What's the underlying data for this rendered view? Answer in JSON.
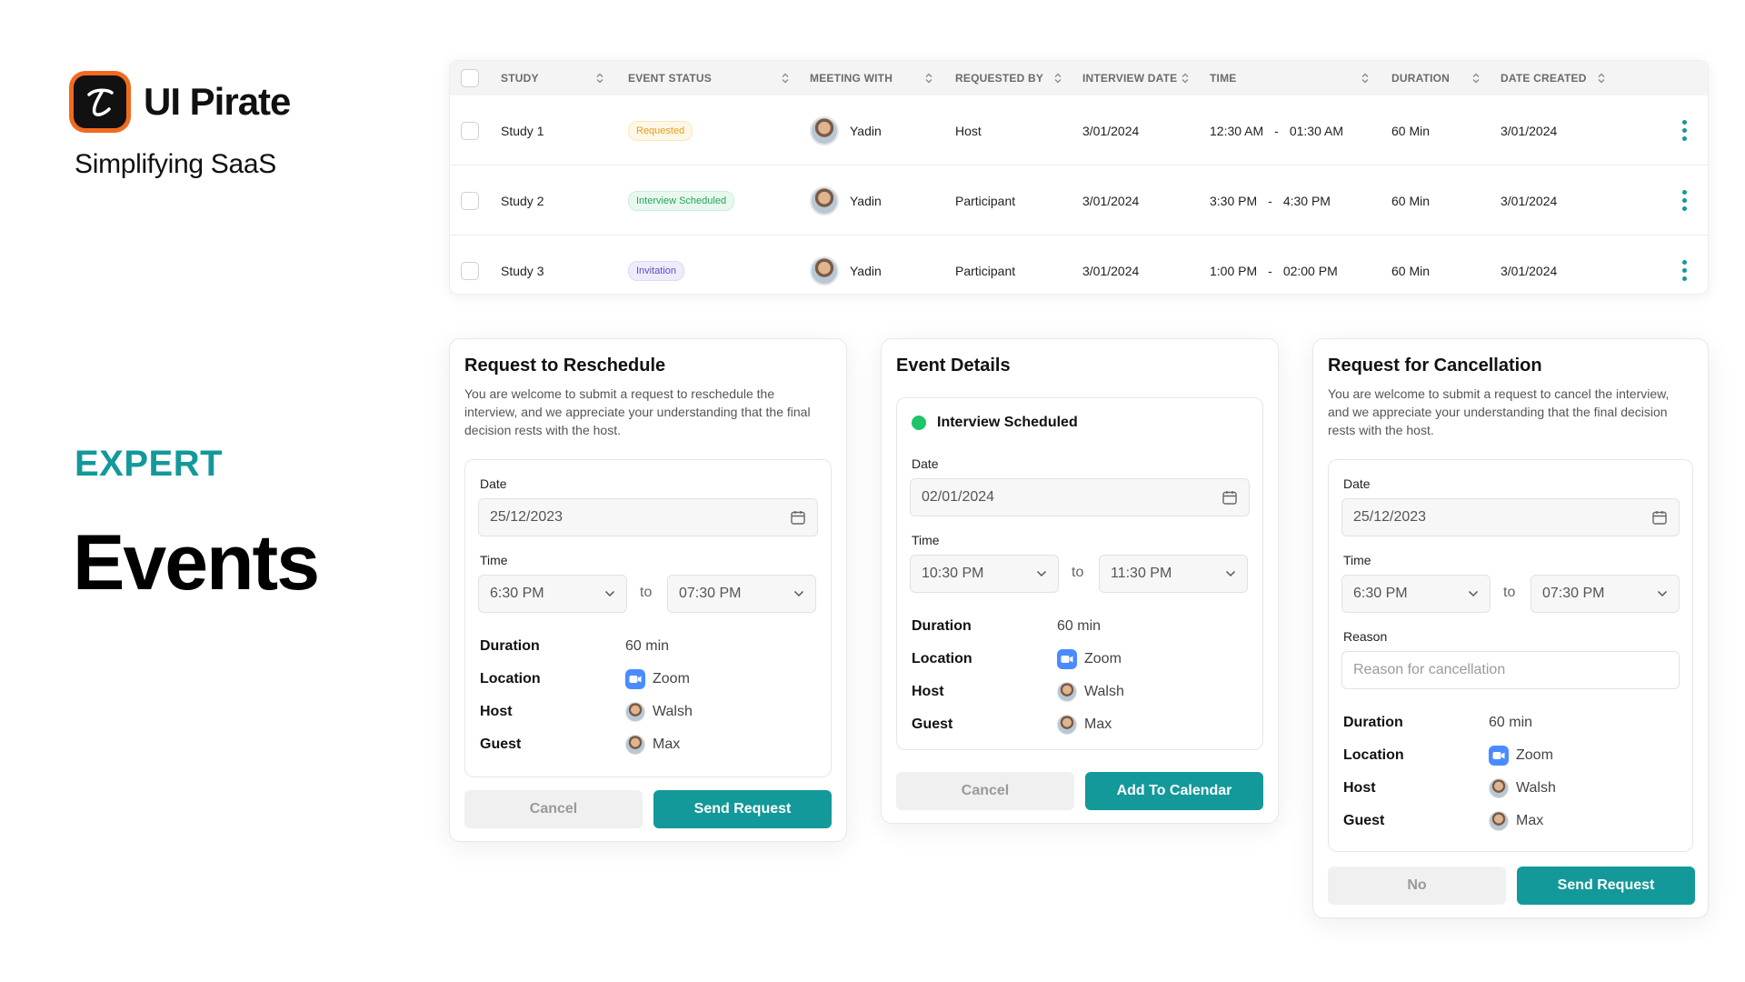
{
  "brand": {
    "name": "UI Pirate",
    "tagline": "Simplifying SaaS",
    "logo_color": "#f26a21"
  },
  "level": "EXPERT",
  "page_title": "Events",
  "accent_color": "#13999a",
  "table": {
    "columns": [
      "STUDY",
      "EVENT STATUS",
      "MEETING WITH",
      "REQUESTED BY",
      "INTERVIEW DATE",
      "TIME",
      "DURATION",
      "DATE CREATED"
    ],
    "rows": [
      {
        "study": "Study 1",
        "status": "Requested",
        "status_bg": "#fff7e6",
        "status_fg": "#e0a020",
        "meeting_with": "Yadin",
        "requested_by": "Host",
        "interview_date": "3/01/2024",
        "time_start": "12:30 AM",
        "time_sep": "-",
        "time_end": "01:30 AM",
        "duration": "60 Min",
        "date_created": "3/01/2024"
      },
      {
        "study": "Study 2",
        "status": "Interview Scheduled",
        "status_bg": "#e9f8ef",
        "status_fg": "#24a35a",
        "meeting_with": "Yadin",
        "requested_by": "Participant",
        "interview_date": "3/01/2024",
        "time_start": "3:30 PM",
        "time_sep": "-",
        "time_end": "4:30 PM",
        "duration": "60 Min",
        "date_created": "3/01/2024"
      },
      {
        "study": "Study 3",
        "status": "Invitation",
        "status_bg": "#eeecfb",
        "status_fg": "#5a4fc2",
        "meeting_with": "Yadin",
        "requested_by": "Participant",
        "interview_date": "3/01/2024",
        "time_start": "1:00 PM",
        "time_sep": "-",
        "time_end": "02:00 PM",
        "duration": "60 Min",
        "date_created": "3/01/2024"
      }
    ]
  },
  "reschedule": {
    "title": "Request to Reschedule",
    "description": "You are welcome to submit a request to reschedule the interview, and we appreciate your understanding that the final decision rests with the host.",
    "date_label": "Date",
    "date_value": "25/12/2023",
    "time_label": "Time",
    "time_from": "6:30 PM",
    "to": "to",
    "time_to": "07:30 PM",
    "duration_label": "Duration",
    "duration_value": "60 min",
    "location_label": "Location",
    "location_value": "Zoom",
    "host_label": "Host",
    "host_value": "Walsh",
    "guest_label": "Guest",
    "guest_value": "Max",
    "cancel": "Cancel",
    "submit": "Send Request"
  },
  "details": {
    "title": "Event Details",
    "status": "Interview Scheduled",
    "status_color": "#1ec46a",
    "date_label": "Date",
    "date_value": "02/01/2024",
    "time_label": "Time",
    "time_from": "10:30 PM",
    "to": "to",
    "time_to": "11:30 PM",
    "duration_label": "Duration",
    "duration_value": "60 min",
    "location_label": "Location",
    "location_value": "Zoom",
    "host_label": "Host",
    "host_value": "Walsh",
    "guest_label": "Guest",
    "guest_value": "Max",
    "cancel": "Cancel",
    "submit": "Add To Calendar"
  },
  "cancellation": {
    "title": "Request for Cancellation",
    "description": "You are welcome to submit a request to cancel the interview, and we appreciate your understanding that the final decision rests with the host.",
    "date_label": "Date",
    "date_value": "25/12/2023",
    "time_label": "Time",
    "time_from": "6:30 PM",
    "to": "to",
    "time_to": "07:30 PM",
    "reason_label": "Reason",
    "reason_placeholder": "Reason for cancellation",
    "duration_label": "Duration",
    "duration_value": "60 min",
    "location_label": "Location",
    "location_value": "Zoom",
    "host_label": "Host",
    "host_value": "Walsh",
    "guest_label": "Guest",
    "guest_value": "Max",
    "cancel": "No",
    "submit": "Send Request"
  }
}
